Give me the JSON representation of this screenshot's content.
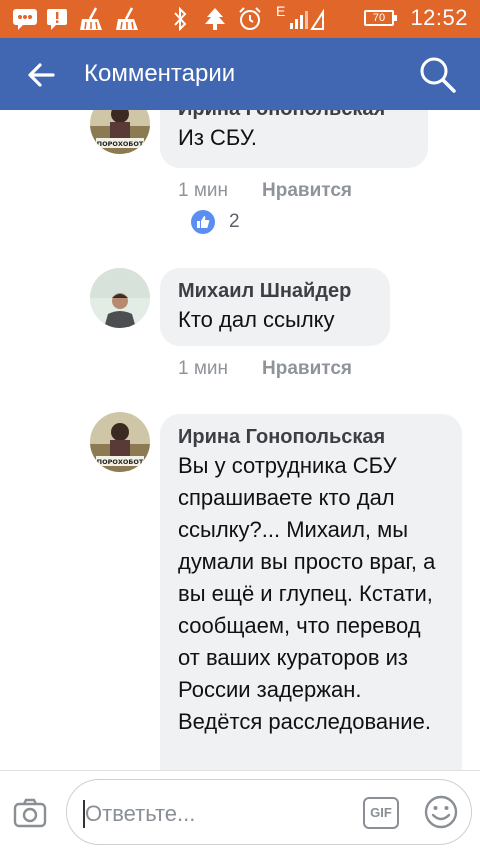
{
  "status_bar": {
    "time": "12:52",
    "battery": "70",
    "network": "E",
    "colors": {
      "background": "#e0662a"
    }
  },
  "app_bar": {
    "title": "Комментарии",
    "back_icon": "arrow-left-icon",
    "search_icon": "search-icon",
    "colors": {
      "background": "#4267b2"
    }
  },
  "comments": [
    {
      "author": "Ирина Гонопольская",
      "text": "Из СБУ.",
      "time": "1 мин",
      "like_label": "Нравится",
      "reactions": {
        "icon": "thumbs-up-icon",
        "count": "2"
      },
      "avatar_label": "ПОРОХОБОТ"
    },
    {
      "author": "Михаил Шнайдер",
      "text": "Кто дал ссылку",
      "time": "1 мин",
      "like_label": "Нравится"
    },
    {
      "author": "Ирина Гонопольская",
      "text": "Вы у сотрудника СБУ спрашиваете кто дал ссылку?... Михаил, мы думали вы просто враг, а вы ещё и глупец. Кстати, сообщаем, что перевод от ваших кураторов из России задержан. Ведётся расследование.",
      "avatar_label": "ПОРОХОБОТ"
    }
  ],
  "composer": {
    "placeholder": "Ответьте...",
    "gif_label": "GIF",
    "camera_icon": "camera-icon",
    "emoji_icon": "smiley-icon"
  }
}
